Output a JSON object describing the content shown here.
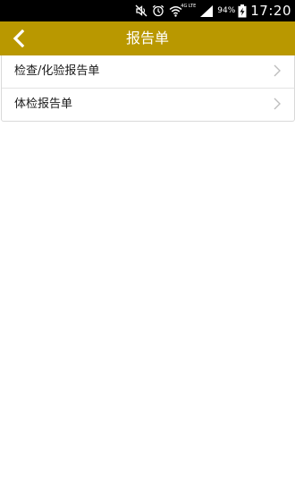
{
  "status_bar": {
    "network_label": "4G LTE",
    "battery_percent": "94%",
    "time": "17:20",
    "icons": [
      "mute-icon",
      "alarm-icon",
      "wifi-icon",
      "signal-icon",
      "battery-charging-icon"
    ]
  },
  "header": {
    "title": "报告单",
    "back_icon": "chevron-left-icon",
    "background_color": "#b99800"
  },
  "report_list": {
    "items": [
      {
        "label": "检查/化验报告单",
        "icon": "chevron-right-icon"
      },
      {
        "label": "体检报告单",
        "icon": "chevron-right-icon"
      }
    ]
  }
}
